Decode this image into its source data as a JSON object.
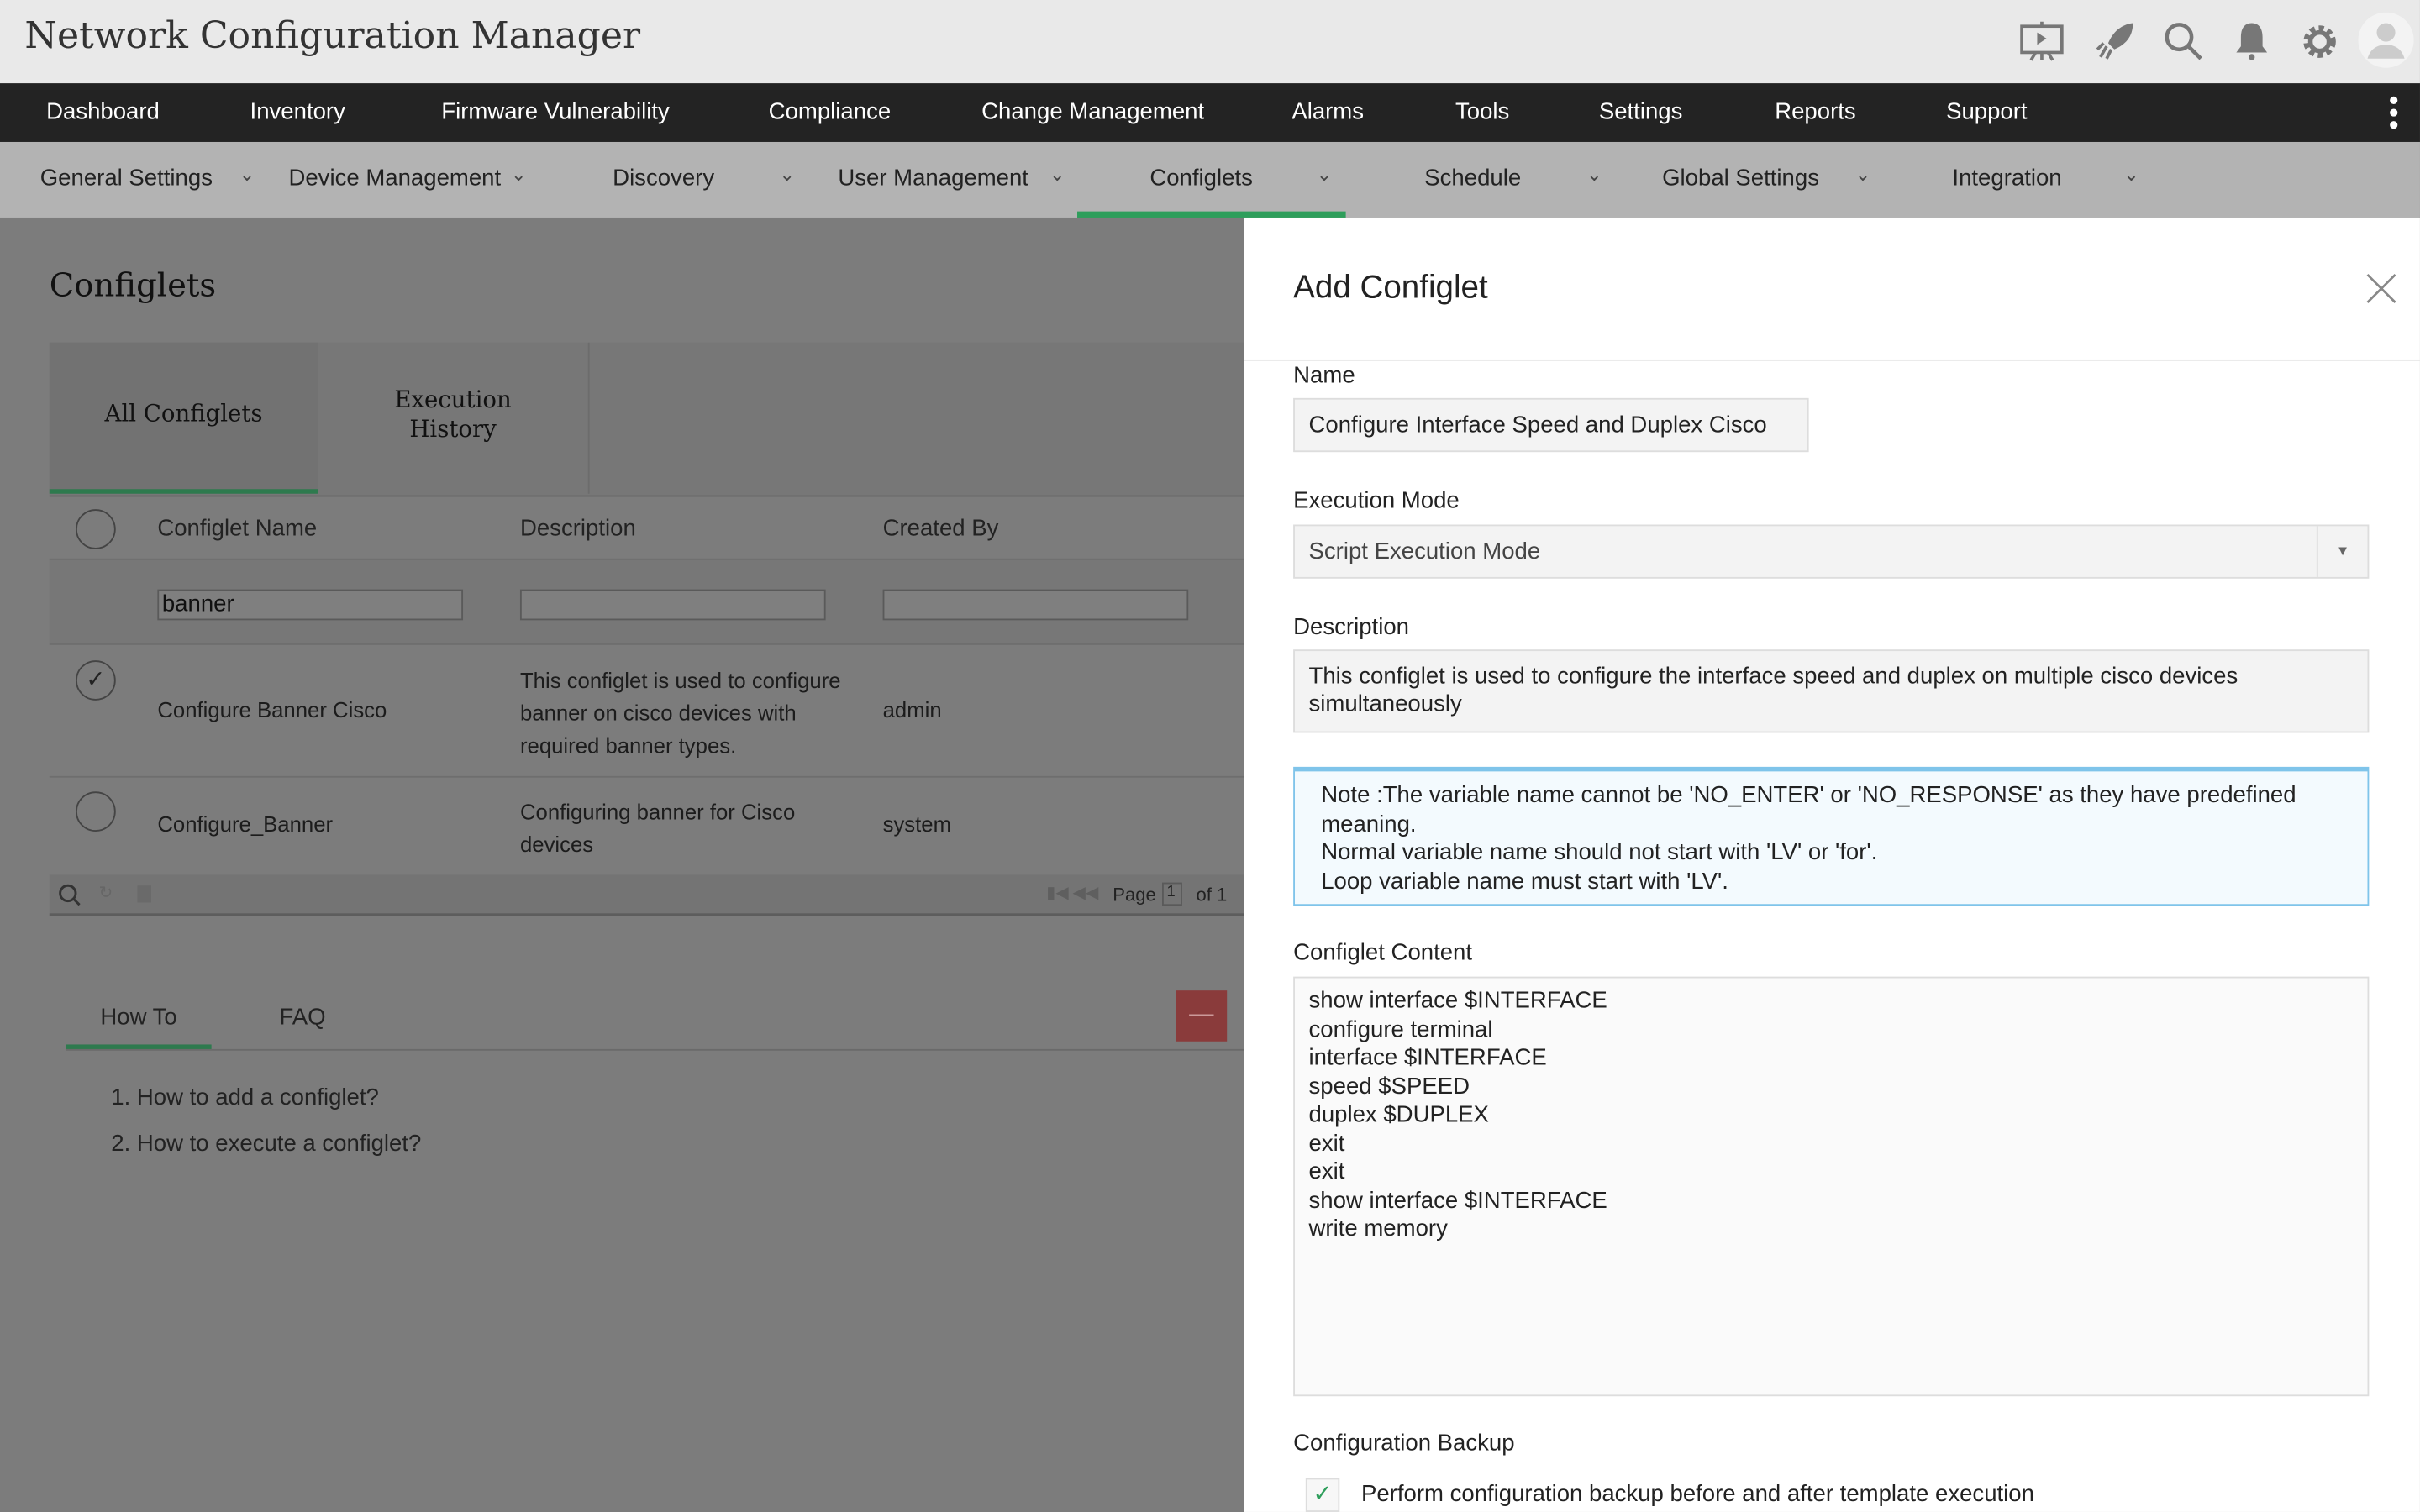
{
  "app_title": "Network Configuration Manager",
  "top_icons": [
    "presentation-icon",
    "rocket-icon",
    "search-icon",
    "bell-icon",
    "gear-icon",
    "avatar-icon"
  ],
  "nav": [
    "Dashboard",
    "Inventory",
    "Firmware Vulnerability",
    "Compliance",
    "Change Management",
    "Alarms",
    "Tools",
    "Settings",
    "Reports",
    "Support"
  ],
  "subnav": [
    "General Settings",
    "Device Management",
    "Discovery",
    "User Management",
    "Configlets",
    "Schedule",
    "Global Settings",
    "Integration"
  ],
  "page_title": "Configlets",
  "tabs": [
    "All Configlets",
    "Execution History"
  ],
  "table": {
    "headers": [
      "Configlet Name",
      "Description",
      "Created By"
    ],
    "filter_name": "banner",
    "rows": [
      {
        "name": "Configure Banner Cisco",
        "description": "This configlet is used to configure banner on cisco devices with required banner types.",
        "created_by": "admin",
        "checked": true
      },
      {
        "name": "Configure_Banner",
        "description": "Configuring banner for Cisco devices",
        "created_by": "system",
        "checked": false
      }
    ],
    "pager": {
      "page_label": "Page",
      "page": "1",
      "of": "of 1"
    }
  },
  "help": {
    "tabs": [
      "How To",
      "FAQ"
    ],
    "items": [
      "1. How to add a configlet?",
      "2. How to execute a configlet?"
    ]
  },
  "panel": {
    "title": "Add Configlet",
    "name_label": "Name",
    "name_value": "Configure Interface Speed and Duplex Cisco",
    "mode_label": "Execution Mode",
    "mode_value": "Script Execution Mode",
    "desc_label": "Description",
    "desc_value": "This configlet is used to configure the interface speed and duplex on multiple cisco devices simultaneously",
    "note": [
      "Note :The variable name cannot be 'NO_ENTER' or 'NO_RESPONSE' as they have predefined meaning.",
      "Normal variable name should not start with 'LV' or 'for'.",
      "Loop variable name must start with 'LV'."
    ],
    "content_label": "Configlet Content",
    "content": [
      "show interface $INTERFACE",
      "configure terminal",
      "interface $INTERFACE",
      "speed $SPEED",
      "duplex $DUPLEX",
      "exit",
      "exit",
      "show interface $INTERFACE",
      "write memory"
    ],
    "backup_label": "Configuration Backup",
    "backup_option": "Perform configuration backup before and after template execution",
    "backup_checked": true
  },
  "colors": {
    "accent": "#2e9e5b",
    "note_border": "#7fc4ea",
    "collapse_button": "#b33a3a"
  }
}
